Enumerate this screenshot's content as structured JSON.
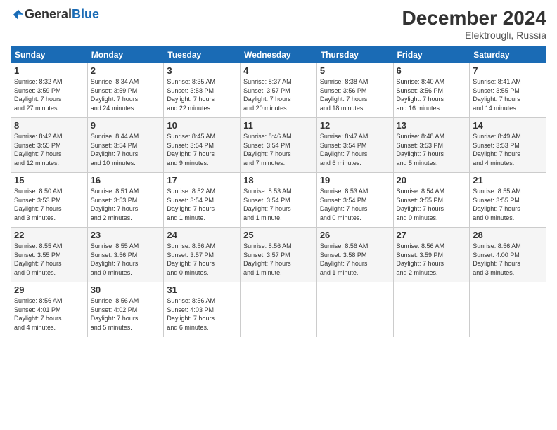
{
  "header": {
    "logo_general": "General",
    "logo_blue": "Blue",
    "month_year": "December 2024",
    "location": "Elektrougli, Russia"
  },
  "weekdays": [
    "Sunday",
    "Monday",
    "Tuesday",
    "Wednesday",
    "Thursday",
    "Friday",
    "Saturday"
  ],
  "weeks": [
    [
      {
        "day": "1",
        "info": "Sunrise: 8:32 AM\nSunset: 3:59 PM\nDaylight: 7 hours\nand 27 minutes."
      },
      {
        "day": "2",
        "info": "Sunrise: 8:34 AM\nSunset: 3:59 PM\nDaylight: 7 hours\nand 24 minutes."
      },
      {
        "day": "3",
        "info": "Sunrise: 8:35 AM\nSunset: 3:58 PM\nDaylight: 7 hours\nand 22 minutes."
      },
      {
        "day": "4",
        "info": "Sunrise: 8:37 AM\nSunset: 3:57 PM\nDaylight: 7 hours\nand 20 minutes."
      },
      {
        "day": "5",
        "info": "Sunrise: 8:38 AM\nSunset: 3:56 PM\nDaylight: 7 hours\nand 18 minutes."
      },
      {
        "day": "6",
        "info": "Sunrise: 8:40 AM\nSunset: 3:56 PM\nDaylight: 7 hours\nand 16 minutes."
      },
      {
        "day": "7",
        "info": "Sunrise: 8:41 AM\nSunset: 3:55 PM\nDaylight: 7 hours\nand 14 minutes."
      }
    ],
    [
      {
        "day": "8",
        "info": "Sunrise: 8:42 AM\nSunset: 3:55 PM\nDaylight: 7 hours\nand 12 minutes."
      },
      {
        "day": "9",
        "info": "Sunrise: 8:44 AM\nSunset: 3:54 PM\nDaylight: 7 hours\nand 10 minutes."
      },
      {
        "day": "10",
        "info": "Sunrise: 8:45 AM\nSunset: 3:54 PM\nDaylight: 7 hours\nand 9 minutes."
      },
      {
        "day": "11",
        "info": "Sunrise: 8:46 AM\nSunset: 3:54 PM\nDaylight: 7 hours\nand 7 minutes."
      },
      {
        "day": "12",
        "info": "Sunrise: 8:47 AM\nSunset: 3:54 PM\nDaylight: 7 hours\nand 6 minutes."
      },
      {
        "day": "13",
        "info": "Sunrise: 8:48 AM\nSunset: 3:53 PM\nDaylight: 7 hours\nand 5 minutes."
      },
      {
        "day": "14",
        "info": "Sunrise: 8:49 AM\nSunset: 3:53 PM\nDaylight: 7 hours\nand 4 minutes."
      }
    ],
    [
      {
        "day": "15",
        "info": "Sunrise: 8:50 AM\nSunset: 3:53 PM\nDaylight: 7 hours\nand 3 minutes."
      },
      {
        "day": "16",
        "info": "Sunrise: 8:51 AM\nSunset: 3:53 PM\nDaylight: 7 hours\nand 2 minutes."
      },
      {
        "day": "17",
        "info": "Sunrise: 8:52 AM\nSunset: 3:54 PM\nDaylight: 7 hours\nand 1 minute."
      },
      {
        "day": "18",
        "info": "Sunrise: 8:53 AM\nSunset: 3:54 PM\nDaylight: 7 hours\nand 1 minute."
      },
      {
        "day": "19",
        "info": "Sunrise: 8:53 AM\nSunset: 3:54 PM\nDaylight: 7 hours\nand 0 minutes."
      },
      {
        "day": "20",
        "info": "Sunrise: 8:54 AM\nSunset: 3:55 PM\nDaylight: 7 hours\nand 0 minutes."
      },
      {
        "day": "21",
        "info": "Sunrise: 8:55 AM\nSunset: 3:55 PM\nDaylight: 7 hours\nand 0 minutes."
      }
    ],
    [
      {
        "day": "22",
        "info": "Sunrise: 8:55 AM\nSunset: 3:55 PM\nDaylight: 7 hours\nand 0 minutes."
      },
      {
        "day": "23",
        "info": "Sunrise: 8:55 AM\nSunset: 3:56 PM\nDaylight: 7 hours\nand 0 minutes."
      },
      {
        "day": "24",
        "info": "Sunrise: 8:56 AM\nSunset: 3:57 PM\nDaylight: 7 hours\nand 0 minutes."
      },
      {
        "day": "25",
        "info": "Sunrise: 8:56 AM\nSunset: 3:57 PM\nDaylight: 7 hours\nand 1 minute."
      },
      {
        "day": "26",
        "info": "Sunrise: 8:56 AM\nSunset: 3:58 PM\nDaylight: 7 hours\nand 1 minute."
      },
      {
        "day": "27",
        "info": "Sunrise: 8:56 AM\nSunset: 3:59 PM\nDaylight: 7 hours\nand 2 minutes."
      },
      {
        "day": "28",
        "info": "Sunrise: 8:56 AM\nSunset: 4:00 PM\nDaylight: 7 hours\nand 3 minutes."
      }
    ],
    [
      {
        "day": "29",
        "info": "Sunrise: 8:56 AM\nSunset: 4:01 PM\nDaylight: 7 hours\nand 4 minutes."
      },
      {
        "day": "30",
        "info": "Sunrise: 8:56 AM\nSunset: 4:02 PM\nDaylight: 7 hours\nand 5 minutes."
      },
      {
        "day": "31",
        "info": "Sunrise: 8:56 AM\nSunset: 4:03 PM\nDaylight: 7 hours\nand 6 minutes."
      },
      null,
      null,
      null,
      null
    ]
  ]
}
